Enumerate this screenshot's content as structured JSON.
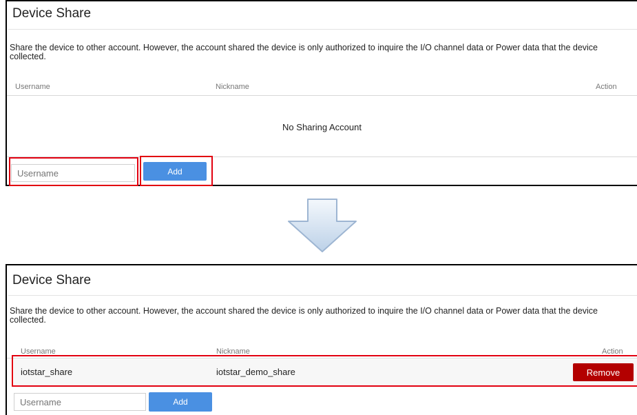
{
  "before": {
    "title": "Device Share",
    "description": "Share the device to other account. However, the account shared the device is only authorized to inquire the I/O channel data or Power data that the device collected.",
    "columns": {
      "username": "Username",
      "nickname": "Nickname",
      "action": "Action"
    },
    "empty_message": "No Sharing Account",
    "username_placeholder": "Username",
    "add_label": "Add"
  },
  "after": {
    "title": "Device Share",
    "description": "Share the device to other account. However, the account shared the device is only authorized to inquire the I/O channel data or Power data that the device collected.",
    "columns": {
      "username": "Username",
      "nickname": "Nickname",
      "action": "Action"
    },
    "rows": [
      {
        "username": "iotstar_share",
        "nickname": "iotstar_demo_share",
        "action_label": "Remove"
      }
    ],
    "username_placeholder": "Username",
    "add_label": "Add"
  },
  "colors": {
    "highlight": "#e2000f",
    "add_button": "#4a90e2",
    "remove_button": "#b30000"
  },
  "transition_icon": "down-arrow-icon"
}
